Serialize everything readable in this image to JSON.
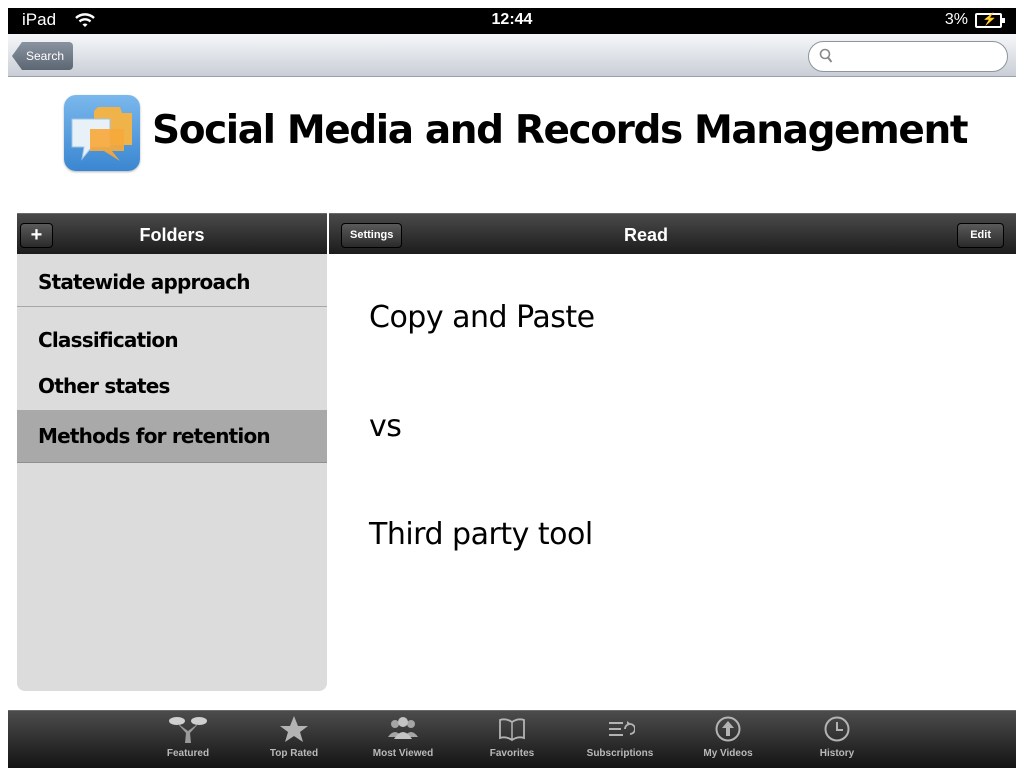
{
  "status_bar": {
    "carrier": "iPad",
    "time": "12:44",
    "battery": "3%"
  },
  "nav_bar": {
    "back_label": "Search",
    "search_placeholder": "",
    "search_value": ""
  },
  "page": {
    "title": "Social Media and Records Management"
  },
  "folders_panel": {
    "add_label": "+",
    "title": "Folders",
    "items": [
      {
        "label": "Statewide approach",
        "selected": false
      },
      {
        "label": "Classification",
        "selected": false
      },
      {
        "label": "Other states",
        "selected": false
      },
      {
        "label": "Methods for retention",
        "selected": true
      }
    ]
  },
  "read_panel": {
    "settings_label": "Settings",
    "title": "Read",
    "edit_label": "Edit",
    "lines": [
      "Copy and Paste",
      "vs",
      "Third party tool"
    ]
  },
  "tab_bar": {
    "tabs": [
      {
        "label": "Featured",
        "icon": "featured-icon"
      },
      {
        "label": "Top Rated",
        "icon": "star-icon"
      },
      {
        "label": "Most Viewed",
        "icon": "people-icon"
      },
      {
        "label": "Favorites",
        "icon": "book-icon"
      },
      {
        "label": "Subscriptions",
        "icon": "subscriptions-icon"
      },
      {
        "label": "My Videos",
        "icon": "upload-icon"
      },
      {
        "label": "History",
        "icon": "clock-icon"
      }
    ]
  }
}
